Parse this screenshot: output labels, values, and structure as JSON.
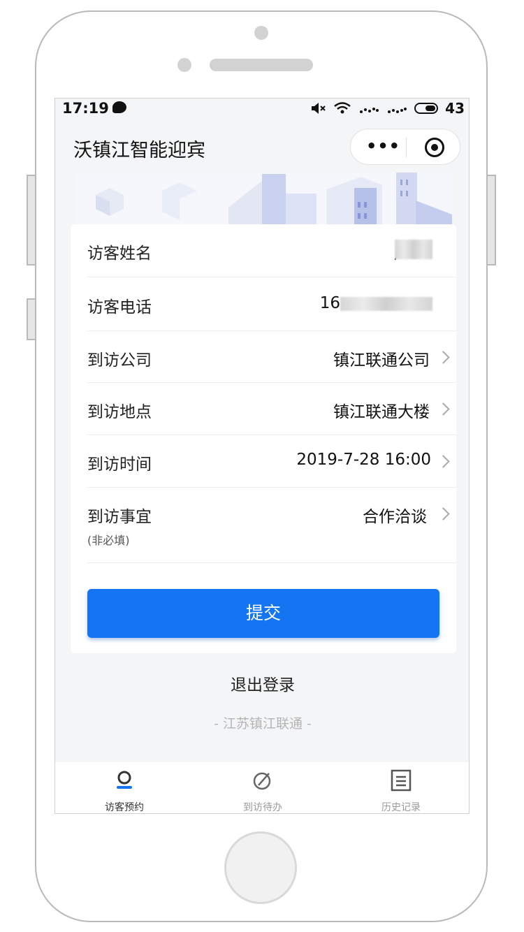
{
  "status_bar": {
    "time": "17:19",
    "battery": "43"
  },
  "navbar": {
    "title": "沃镇江智能迎宾",
    "more_label": "•••"
  },
  "form": {
    "rows": [
      {
        "label": "访客姓名",
        "value": "严"
      },
      {
        "label": "访客电话",
        "value": "16"
      },
      {
        "label": "到访公司",
        "value": "镇江联通公司"
      },
      {
        "label": "到访地点",
        "value": "镇江联通大楼"
      },
      {
        "label": "到访时间",
        "value": "2019-7-28 16:00"
      },
      {
        "label": "到访事宜",
        "sublabel": "(非必填)",
        "value": "合作洽谈"
      }
    ],
    "submit_label": "提交"
  },
  "logout_label": "退出登录",
  "footer_note": "- 江苏镇江联通 -",
  "tabbar": {
    "tabs": [
      {
        "label": "访客预约",
        "icon": "person-icon",
        "active": true
      },
      {
        "label": "到访待办",
        "icon": "compass-icon",
        "active": false
      },
      {
        "label": "历史记录",
        "icon": "list-icon",
        "active": false
      }
    ]
  },
  "colors": {
    "accent": "#1475f3",
    "background": "#f4f5f7"
  }
}
